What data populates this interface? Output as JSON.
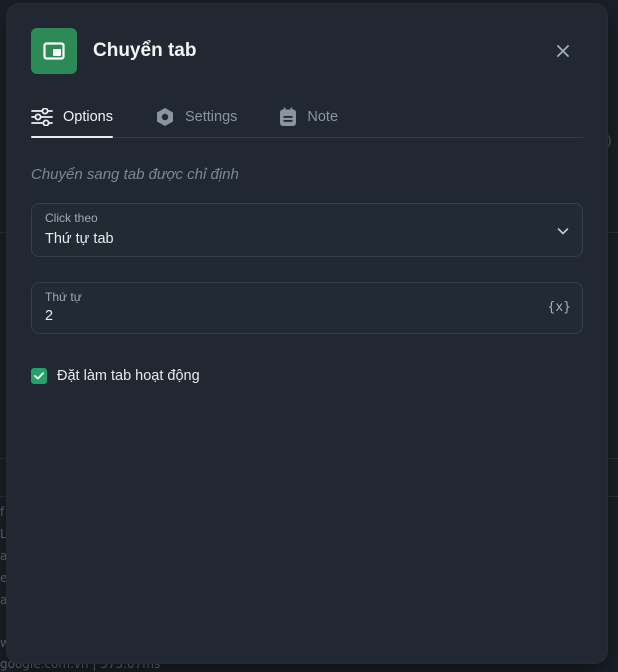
{
  "background": {
    "fragments": [
      "f",
      "L",
      "a",
      "e",
      "a",
      "w",
      "google.com.vn | 575.07ms"
    ],
    "fragment_right": ")"
  },
  "modal": {
    "title": "Chuyển tab",
    "app_icon": "tab-window-icon",
    "close_icon": "close-icon"
  },
  "tabs": [
    {
      "label": "Options",
      "icon": "sliders-icon",
      "active": true
    },
    {
      "label": "Settings",
      "icon": "hexagon-gear-icon",
      "active": false
    },
    {
      "label": "Note",
      "icon": "note-icon",
      "active": false
    }
  ],
  "content": {
    "description": "Chuyển sang tab được chỉ định",
    "click_by": {
      "label": "Click theo",
      "value": "Thứ tự tab"
    },
    "order": {
      "label": "Thứ tự",
      "value": "2",
      "variable_button": "{x}"
    },
    "set_active": {
      "label": "Đặt làm tab hoạt động",
      "checked": true
    }
  },
  "colors": {
    "accent_green": "#2b8a56",
    "checkbox_green": "#23a26b",
    "modal_bg": "#212831"
  }
}
